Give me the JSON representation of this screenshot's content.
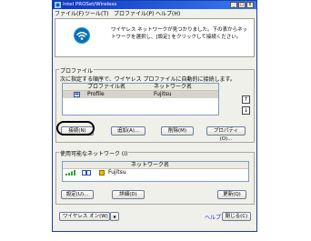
{
  "window": {
    "title": "Intel PROSet/Wireless",
    "minimize": "_",
    "maximize": "□",
    "close": "x"
  },
  "menu": [
    "ファイル(F)",
    "ツール(T)",
    "プロファイル(P)",
    "ヘルプ(H)"
  ],
  "header": {
    "message": "ワイヤレス ネットワークが見つかりました。下の表からネットワークを選択し、[設定] をクリックして接続ください。"
  },
  "profiles": {
    "group_label": "プロファイル",
    "instruction": "次に指定する順序で、ワイヤレス プロファイルに自動的に接続します。",
    "columns": [
      "プロファイル名",
      "ネットワーク名"
    ],
    "rows": [
      {
        "name": "Profile",
        "network": "Fujitsu"
      }
    ],
    "buttons": {
      "connect": "接続(N)",
      "add": "追加(A)...",
      "delete": "削除(M)",
      "properties": "プロパティ(O)..."
    }
  },
  "available": {
    "group_label": "使用可能なネットワーク (I)",
    "columns": [
      "ネットワーク名"
    ],
    "rows": [
      {
        "name": "Fujitsu"
      }
    ],
    "buttons": {
      "settings": "設定(U)...",
      "details": "詳細(D)",
      "refresh": "更新(Q)"
    }
  },
  "footer": {
    "wireless_toggle": "ワイヤレス オン(W)",
    "help": "ヘルプ",
    "close": "閉じる(C)"
  },
  "colors": {
    "titlebar": "#0a36c4",
    "signal": "#2aa82a",
    "highlight": "#000000"
  }
}
